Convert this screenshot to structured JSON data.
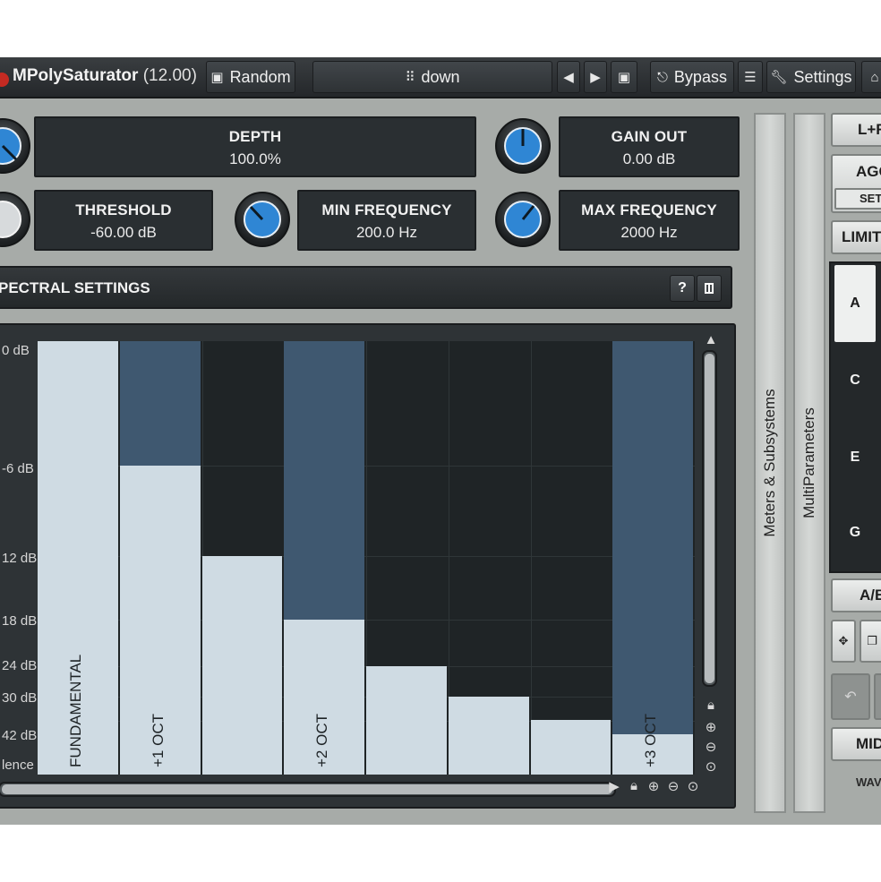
{
  "toolbar": {
    "title": "MPolySaturator",
    "version": "(12.00)",
    "random_label": "Random",
    "preset_name": "down",
    "bypass_label": "Bypass",
    "settings_label": "Settings"
  },
  "params": {
    "depth": {
      "label": "DEPTH",
      "value": "100.0%"
    },
    "gain_out": {
      "label": "GAIN OUT",
      "value": "0.00 dB"
    },
    "threshold": {
      "label": "THRESHOLD",
      "value": "-60.00 dB"
    },
    "min_frequency": {
      "label": "MIN FREQUENCY",
      "value": "200.0 Hz"
    },
    "max_frequency": {
      "label": "MAX FREQUENCY",
      "value": "2000 Hz"
    }
  },
  "spectral": {
    "header": "PECTRAL SETTINGS",
    "help_label": "?",
    "y_labels": [
      "0 dB",
      "-6 dB",
      "12 dB",
      "18 dB",
      "24 dB",
      "30 dB",
      "42 dB",
      "lence"
    ],
    "bar_labels": [
      "FUNDAMENTAL",
      "+1 OCT",
      "",
      "+2 OCT",
      "",
      "",
      "",
      "+3 OCT"
    ],
    "bar_levels": [
      1.0,
      0.712,
      0.505,
      0.358,
      0.25,
      0.18,
      0.125,
      0.093
    ],
    "bar_highlight_levels": [
      1.0,
      1.0,
      0.0,
      1.0,
      0.0,
      0.0,
      0.0,
      1.0
    ]
  },
  "side_panels": {
    "meters": "Meters & Subsystems",
    "multiparameters": "MultiParameters"
  },
  "right_column": {
    "lr_label": "L+R",
    "agc_label": "AGC",
    "set_label": "SET",
    "limit_label": "LIMIT",
    "slots": [
      "A",
      "C",
      "E",
      "G"
    ],
    "ab_label": "A/B",
    "midi_label": "MIDI",
    "wave_label": "WAVE"
  },
  "colors": {
    "accent_blue": "#2f86d4",
    "panel_dark": "#2a2f32",
    "bar_light": "#cfdbe3",
    "bar_highlight": "#3f5870"
  }
}
